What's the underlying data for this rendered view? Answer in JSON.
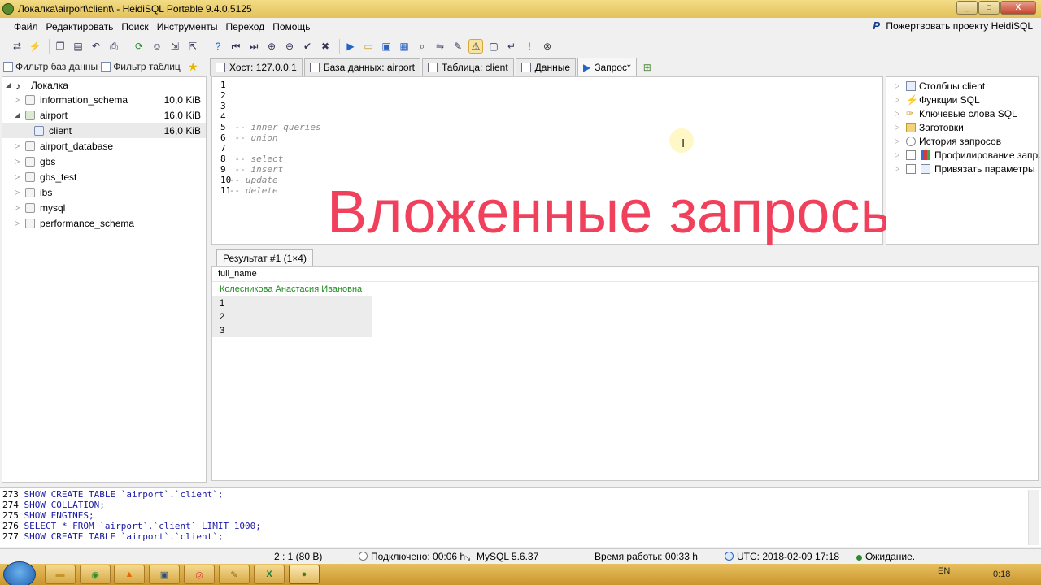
{
  "window": {
    "title": "Локалка\\airport\\client\\ - HeidiSQL Portable 9.4.0.5125",
    "buttons": [
      "_",
      "□",
      "X"
    ]
  },
  "menu": {
    "items": [
      "Файл",
      "Редактировать",
      "Поиск",
      "Инструменты",
      "Переход",
      "Помощь"
    ],
    "donate": "Пожертвовать проекту HeidiSQL"
  },
  "toolbar": {
    "icons": [
      "connect-icon",
      "disconnect-icon",
      "copy-icon",
      "paste-icon",
      "undo-icon",
      "print-icon",
      "refresh-icon",
      "users-icon",
      "import-icon",
      "export-icon",
      "help-icon",
      "first-icon",
      "last-icon",
      "add-icon",
      "remove-icon",
      "ok-icon",
      "cancel-icon",
      "run-icon",
      "open-icon",
      "save-icon",
      "save-as-icon",
      "find-icon",
      "replace-icon",
      "edit-icon",
      "warning-icon",
      "clear-icon",
      "wrap-icon",
      "info-icon",
      "stop-icon"
    ]
  },
  "filters": {
    "db_filter": "Фильтр баз данны",
    "table_filter": "Фильтр таблиц"
  },
  "tree": {
    "root": "Локалка",
    "items": [
      {
        "label": "information_schema",
        "size": "10,0 KiB"
      },
      {
        "label": "airport",
        "size": "16,0 KiB"
      },
      {
        "label": "client",
        "size": "16,0 KiB"
      },
      {
        "label": "airport_database",
        "size": ""
      },
      {
        "label": "gbs",
        "size": ""
      },
      {
        "label": "gbs_test",
        "size": ""
      },
      {
        "label": "ibs",
        "size": ""
      },
      {
        "label": "mysql",
        "size": ""
      },
      {
        "label": "performance_schema",
        "size": ""
      }
    ]
  },
  "tabs": [
    {
      "label": "Хост: 127.0.0.1"
    },
    {
      "label": "База данных: airport"
    },
    {
      "label": "Таблица: client"
    },
    {
      "label": "Данные"
    },
    {
      "label": "Запрос*"
    }
  ],
  "editor": {
    "lines": [
      {
        "num": "1",
        "text": ""
      },
      {
        "num": "2",
        "text": ""
      },
      {
        "num": "3",
        "text": ""
      },
      {
        "num": "4",
        "text": ""
      },
      {
        "num": "5",
        "text": "-- inner queries"
      },
      {
        "num": "6",
        "text": "-- union"
      },
      {
        "num": "7",
        "text": ""
      },
      {
        "num": "8",
        "text": "-- select"
      },
      {
        "num": "9",
        "text": "-- insert"
      },
      {
        "num": "10",
        "text": "-- update"
      },
      {
        "num": "11",
        "text": "-- delete"
      }
    ]
  },
  "overlay": {
    "caption": "Вложенные запросы",
    "color": "#f0405b"
  },
  "helpers": {
    "items": [
      {
        "label": "Столбцы client"
      },
      {
        "label": "Функции SQL"
      },
      {
        "label": "Ключевые слова SQL"
      },
      {
        "label": "Заготовки"
      },
      {
        "label": "История запросов"
      },
      {
        "label": "Профилирование запр..."
      },
      {
        "label": "Привязать параметры"
      }
    ]
  },
  "result": {
    "tab_label": "Результат #1 (1×4)",
    "column": "full_name",
    "rows": [
      "Колесникова Анастасия Ивановна",
      "1",
      "2",
      "3"
    ]
  },
  "log": {
    "lines": [
      {
        "num": "273",
        "text": "SHOW CREATE TABLE `airport`.`client`;"
      },
      {
        "num": "274",
        "text": "SHOW COLLATION;"
      },
      {
        "num": "275",
        "text": "SHOW ENGINES;"
      },
      {
        "num": "276",
        "text": "SELECT * FROM `airport`.`client` LIMIT 1000;"
      },
      {
        "num": "277",
        "text": "SHOW CREATE TABLE `airport`.`client`;"
      }
    ]
  },
  "status": {
    "position": "2 : 1 (80 B)",
    "connected": "Подключено: 00:06 h",
    "server": "MySQL 5.6.37",
    "uptime": "Время работы: 00:33 h",
    "utc": "UTC: 2018-02-09 17:18",
    "state": "Ожидание."
  },
  "taskbar": {
    "lang": "EN",
    "time": "0:18"
  }
}
